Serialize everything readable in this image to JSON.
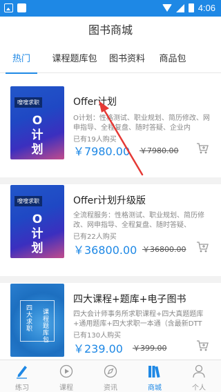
{
  "status_bar": {
    "time": "4:06"
  },
  "header": {
    "title": "图书商城"
  },
  "tabs": [
    {
      "label": "热门",
      "active": true
    },
    {
      "label": "课程题库包",
      "active": false
    },
    {
      "label": "图书资料",
      "active": false
    },
    {
      "label": "商品包",
      "active": false
    }
  ],
  "products": [
    {
      "cover_tag": "嗖嗖求职",
      "cover_big": "O计划",
      "title": "Offer计划",
      "description": "O计划：性格测试、职业规划、简历修改、网申指导、全程复盘、随时答疑、企业内",
      "buyers": "已有19人购买",
      "price": "￥7980.00",
      "original_price": "￥7980.00"
    },
    {
      "cover_tag": "嗖嗖求职",
      "cover_big": "O计划",
      "title": "Offer计划升级版",
      "description": "全流程服务：性格测试、职业规划、简历修改、网申指导、全程复盘、随时答疑、",
      "buyers": "已有22人购买",
      "price": "￥36800.00",
      "original_price": "￥36800.00"
    },
    {
      "cover_left": "四大求职",
      "cover_right": "课程题库包",
      "title": "四大课程+题库+电子图书",
      "description": "四大会计师事务所求职课程+四大真题题库+通用题库+四大求职一本通（含最新DTT",
      "buyers": "已有130人购买",
      "price": "￥239.00",
      "original_price": "￥399.00"
    }
  ],
  "bottom_nav": [
    {
      "label": "练习",
      "icon": "pencil-icon",
      "active": false
    },
    {
      "label": "课程",
      "icon": "play-circle-icon",
      "active": false
    },
    {
      "label": "资讯",
      "icon": "compass-icon",
      "active": false
    },
    {
      "label": "商城",
      "icon": "books-icon",
      "active": true
    },
    {
      "label": "个人",
      "icon": "person-icon",
      "active": false
    }
  ],
  "colors": {
    "accent": "#1e88e5",
    "arrow": "#e53935"
  }
}
